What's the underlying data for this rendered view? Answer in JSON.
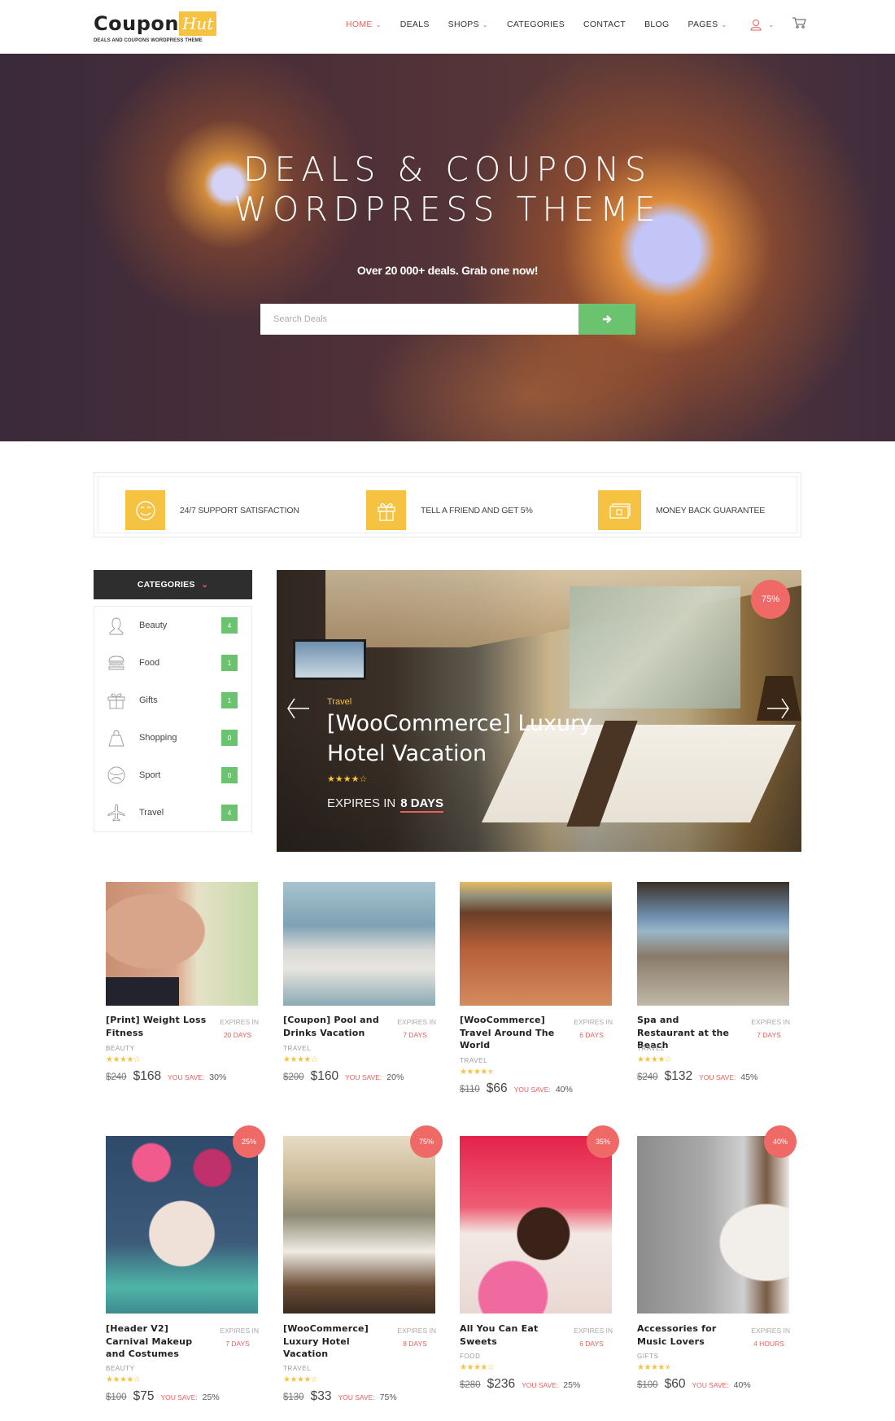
{
  "header": {
    "logo": {
      "main": "Coupon",
      "accent": "Hut",
      "tagline": "DEALS AND COUPONS WORDPRESS THEME"
    },
    "nav": [
      {
        "label": "HOME",
        "active": true,
        "has_dropdown": true
      },
      {
        "label": "DEALS",
        "active": false,
        "has_dropdown": false
      },
      {
        "label": "SHOPS",
        "active": false,
        "has_dropdown": true
      },
      {
        "label": "CATEGORIES",
        "active": false,
        "has_dropdown": false
      },
      {
        "label": "CONTACT",
        "active": false,
        "has_dropdown": false
      },
      {
        "label": "BLOG",
        "active": false,
        "has_dropdown": false
      },
      {
        "label": "PAGES",
        "active": false,
        "has_dropdown": true
      }
    ],
    "user_icon": "user-icon",
    "cart_icon": "cart-icon"
  },
  "hero": {
    "title_line1": "DEALS & COUPONS",
    "title_line2": "WORDPRESS THEME",
    "subtitle": "Over 20 000+ deals. Grab one now!",
    "search": {
      "placeholder": "Search Deals",
      "value": "",
      "button_icon": "arrow-right-icon"
    }
  },
  "features": [
    {
      "icon": "smiley-face-icon",
      "label": "24/7 SUPPORT SATISFACTION"
    },
    {
      "icon": "gift-icon",
      "label": "TELL A FRIEND AND GET 5%"
    },
    {
      "icon": "money-icon",
      "label": "MONEY BACK GUARANTEE"
    }
  ],
  "sidebar": {
    "title": "CATEGORIES",
    "items": [
      {
        "icon": "woman-icon",
        "label": "Beauty",
        "count": "4"
      },
      {
        "icon": "burger-icon",
        "label": "Food",
        "count": "1"
      },
      {
        "icon": "gift-icon",
        "label": "Gifts",
        "count": "1"
      },
      {
        "icon": "shopping-bag-icon",
        "label": "Shopping",
        "count": "0"
      },
      {
        "icon": "ball-icon",
        "label": "Sport",
        "count": "0"
      },
      {
        "icon": "airplane-icon",
        "label": "Travel",
        "count": "4"
      }
    ]
  },
  "slider": {
    "badge": "75%",
    "category": "Travel",
    "title": "[WooCommerce] Luxury Hotel Vacation",
    "rating": 4,
    "rating_max": 5,
    "expires_label": "EXPIRES IN",
    "expires_value": "8 DAYS"
  },
  "colors": {
    "accent_red": "#e8605c",
    "accent_yellow": "#f5c242",
    "accent_green": "#6cc36f",
    "dark": "#2e2e2e"
  },
  "products": [
    {
      "title": "[Print] Weight Loss Fitness",
      "expires_label": "EXPIRES IN",
      "expires": "20 DAYS",
      "category": "BEAUTY",
      "rating": 4,
      "old_price": "$240",
      "price": "$168",
      "save_label": "YOU SAVE:",
      "save": "30%",
      "badge": null
    },
    {
      "title": "[Coupon] Pool and Drinks Vacation",
      "expires_label": "EXPIRES IN",
      "expires": "7 DAYS",
      "category": "TRAVEL",
      "rating": 4,
      "old_price": "$200",
      "price": "$160",
      "save_label": "YOU SAVE:",
      "save": "20%",
      "badge": null
    },
    {
      "title": "[WooCommerce] Travel Around The World",
      "expires_label": "EXPIRES IN",
      "expires": "6 DAYS",
      "category": "TRAVEL",
      "rating": 4.5,
      "old_price": "$110",
      "price": "$66",
      "save_label": "YOU SAVE:",
      "save": "40%",
      "badge": null
    },
    {
      "title": "Spa and Restaurant at the Beach",
      "expires_label": "EXPIRES IN",
      "expires": "7 DAYS",
      "category": "TRAVEL",
      "rating": 4,
      "old_price": "$240",
      "price": "$132",
      "save_label": "YOU SAVE:",
      "save": "45%",
      "badge": null
    },
    {
      "title": "[Header V2] Carnival Makeup and Costumes",
      "expires_label": "EXPIRES IN",
      "expires": "7 DAYS",
      "category": "BEAUTY",
      "rating": 4,
      "old_price": "$100",
      "price": "$75",
      "save_label": "YOU SAVE:",
      "save": "25%",
      "badge": "25%"
    },
    {
      "title": "[WooCommerce] Luxury Hotel Vacation",
      "expires_label": "EXPIRES IN",
      "expires": "8 DAYS",
      "category": "TRAVEL",
      "rating": 4,
      "old_price": "$130",
      "price": "$33",
      "save_label": "YOU SAVE:",
      "save": "75%",
      "badge": "75%"
    },
    {
      "title": "All You Can Eat Sweets",
      "expires_label": "EXPIRES IN",
      "expires": "6 DAYS",
      "category": "FOOD",
      "rating": 4,
      "old_price": "$280",
      "price": "$236",
      "save_label": "YOU SAVE:",
      "save": "25%",
      "badge": "35%"
    },
    {
      "title": "Accessories for Music Lovers",
      "expires_label": "EXPIRES IN",
      "expires": "4 HOURS",
      "category": "GIFTS",
      "rating": 4.5,
      "old_price": "$100",
      "price": "$60",
      "save_label": "YOU SAVE:",
      "save": "40%",
      "badge": "40%"
    }
  ]
}
